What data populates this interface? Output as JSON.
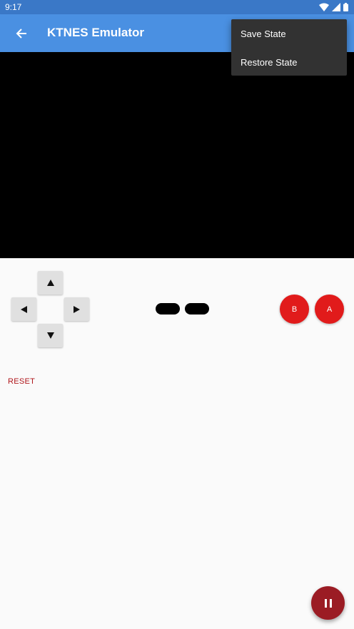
{
  "status_bar": {
    "time": "9:17",
    "icons": [
      "wifi-icon",
      "signal-icon",
      "battery-icon"
    ]
  },
  "app_bar": {
    "title": "KTNES Emulator",
    "back_icon": "arrow-left-icon",
    "color": "#4a90e2"
  },
  "controller": {
    "dpad": {
      "up": "up-arrow",
      "down": "down-arrow",
      "left": "left-arrow",
      "right": "right-arrow"
    },
    "b_label": "B",
    "a_label": "A",
    "button_color": "#e11b1b"
  },
  "reset_label": "RESET",
  "fab": {
    "icon": "pause-icon",
    "color": "#9b1c24"
  },
  "overflow_menu": {
    "items": [
      {
        "label": "Save State"
      },
      {
        "label": "Restore State"
      }
    ]
  }
}
